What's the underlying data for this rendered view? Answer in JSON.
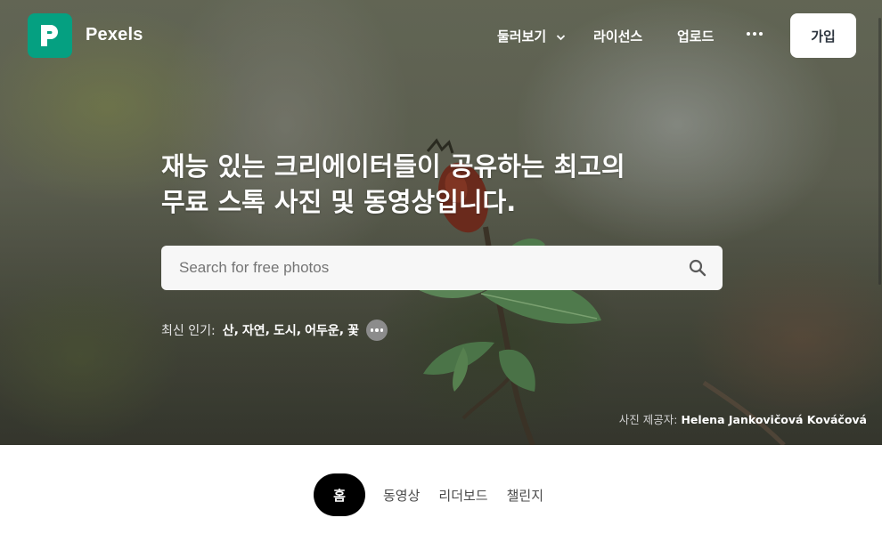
{
  "brand": {
    "name": "Pexels",
    "accent": "#05a081"
  },
  "nav": {
    "explore_label": "둘러보기",
    "license_label": "라이선스",
    "upload_label": "업로드",
    "join_label": "가입"
  },
  "hero": {
    "headline_line1": "재능 있는 크리에이터들이 공유하는 최고의",
    "headline_line2": "무료 스톡 사진 및 동영상입니다.",
    "search_placeholder": "Search for free photos",
    "trending_label": "최신 인기:",
    "trending_tags": [
      "산",
      "자연",
      "도시",
      "어두운",
      "꽃"
    ],
    "credit_label": "사진 제공자:",
    "credit_name": "Helena Jankovičová Kováčová"
  },
  "tabs": [
    "홈",
    "동영상",
    "리더보드",
    "챌린지"
  ]
}
